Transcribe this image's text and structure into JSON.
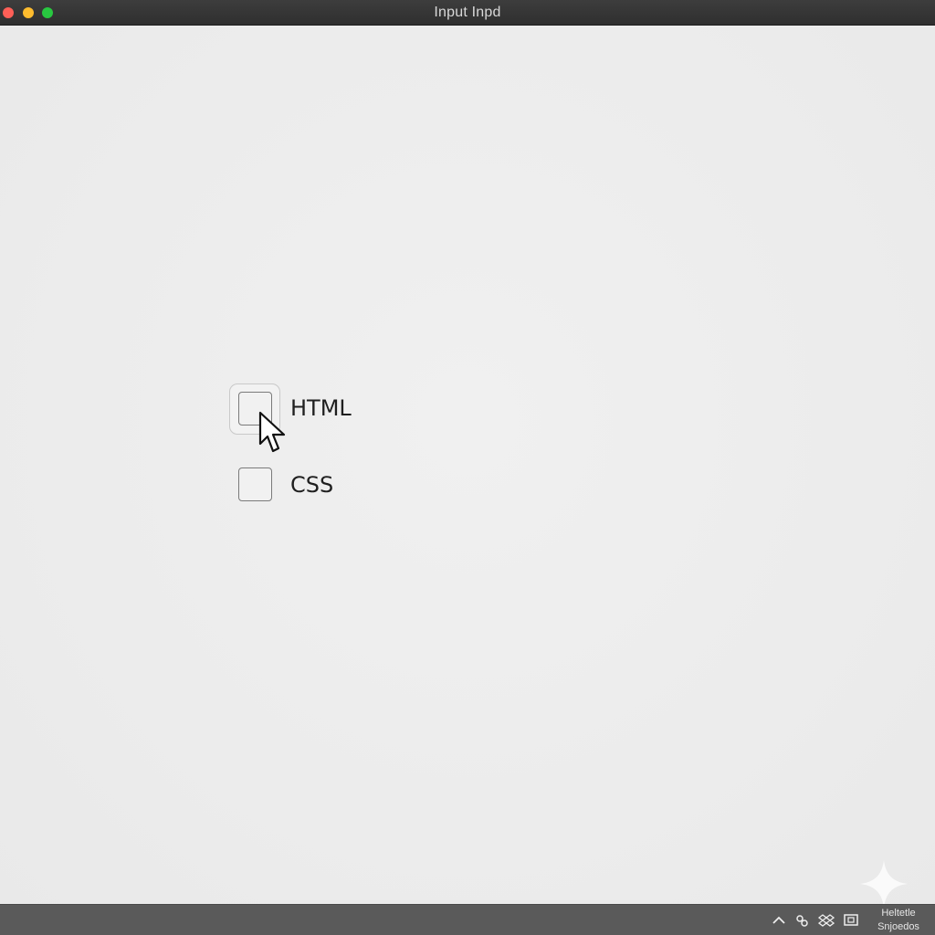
{
  "window": {
    "title": "Input Inpd",
    "controls": {
      "close_color": "#ff5f57",
      "minimize_color": "#febc2e",
      "maximize_color": "#28c840"
    }
  },
  "checkboxes": [
    {
      "label": "HTML",
      "checked": false,
      "focused": true
    },
    {
      "label": "CSS",
      "checked": false,
      "focused": false
    }
  ],
  "cursor": {
    "icon": "arrow-cursor-icon"
  },
  "watermark": {
    "icon": "sparkle-icon"
  },
  "taskbar": {
    "tray_icons": [
      "chevron-up-icon",
      "network-icon",
      "dropbox-icon",
      "display-icon"
    ],
    "tray_text_line1": "Heltetle",
    "tray_text_line2": "Snjoedos"
  }
}
